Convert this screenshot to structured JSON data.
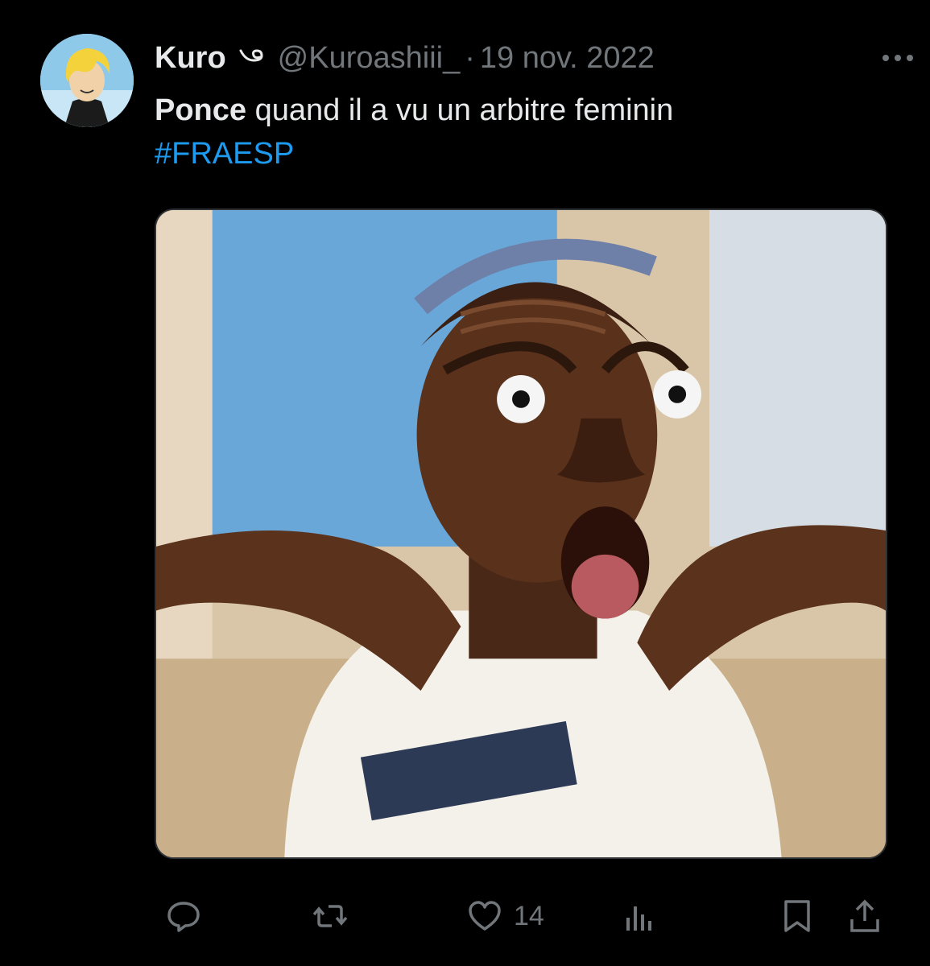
{
  "tweet": {
    "display_name": "Kuro",
    "handle": "@Kuroashiii_",
    "separator": "·",
    "date": "19 nov. 2022",
    "text_mention": "Ponce",
    "text_body": " quand il a vu un arbitre feminin",
    "hashtag": "#FRAESP",
    "like_count": "14"
  },
  "icons": {
    "more": "more-horizontal-icon",
    "reply": "reply-icon",
    "retweet": "retweet-icon",
    "like": "heart-icon",
    "views": "analytics-icon",
    "bookmark": "bookmark-icon",
    "share": "share-icon"
  },
  "colors": {
    "background": "#000000",
    "text": "#e7e9ea",
    "muted": "#71767b",
    "link": "#1d9bf0"
  }
}
